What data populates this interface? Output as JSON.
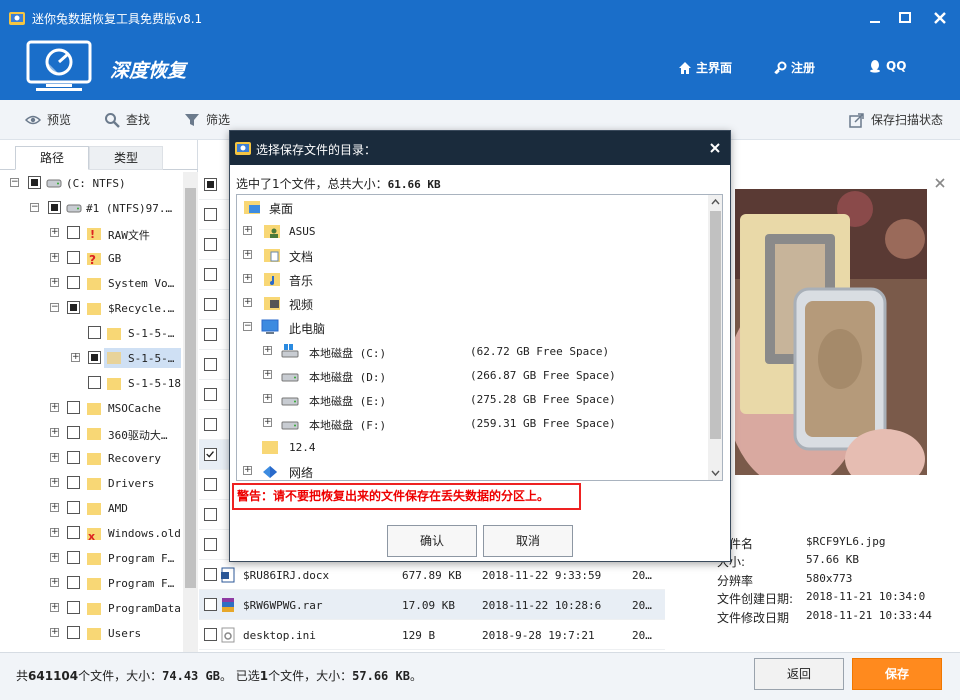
{
  "window": {
    "title": "迷你兔数据恢复工具免费版v8.1"
  },
  "header": {
    "brand": "深度恢复",
    "nav": [
      {
        "label": "主界面",
        "icon": "home-icon"
      },
      {
        "label": "注册",
        "icon": "key-icon"
      },
      {
        "label": "QQ",
        "icon": "qq-icon"
      }
    ]
  },
  "toolbar": {
    "preview": "预览",
    "search": "查找",
    "filter": "筛选",
    "save_scan": "保存扫描状态"
  },
  "left": {
    "tabs": [
      "路径",
      "类型"
    ],
    "tree": [
      {
        "label": "(C: NTFS)"
      },
      {
        "label": "#1 (NTFS)97.…"
      },
      {
        "label": "RAW文件"
      },
      {
        "label": "GB"
      },
      {
        "label": "System Vo…"
      },
      {
        "label": "$Recycle.…"
      },
      {
        "label": "S-1-5-…"
      },
      {
        "label": "S-1-5-…"
      },
      {
        "label": "S-1-5-18"
      },
      {
        "label": "MSOCache"
      },
      {
        "label": "360驱动大…"
      },
      {
        "label": "Recovery"
      },
      {
        "label": "Drivers"
      },
      {
        "label": "AMD"
      },
      {
        "label": "Windows.old"
      },
      {
        "label": "Program F…"
      },
      {
        "label": "Program F…"
      },
      {
        "label": "ProgramData"
      },
      {
        "label": "Users"
      }
    ]
  },
  "files": [
    {
      "name": "$RU86IRJ.docx",
      "size": "677.89 KB",
      "date": "2018-11-22 9:33:59",
      "extra": "20…"
    },
    {
      "name": "$RW6WPWG.rar",
      "size": "17.09 KB",
      "date": "2018-11-22 10:28:6",
      "extra": "20…"
    },
    {
      "name": "desktop.ini",
      "size": "129 B",
      "date": "2018-9-28 19:7:21",
      "extra": "20…"
    }
  ],
  "preview": {
    "info": [
      {
        "k": "文件名",
        "v": "$RCF9YL6.jpg"
      },
      {
        "k": "大小:",
        "v": "57.66 KB"
      },
      {
        "k": "分辨率",
        "v": "580x773"
      },
      {
        "k": "文件创建日期:",
        "v": "2018-11-21 10:34:0"
      },
      {
        "k": "文件修改日期",
        "v": "2018-11-21 10:33:44"
      }
    ]
  },
  "status": {
    "text_prefix": "共",
    "file_count": "641104",
    "text_mid1": "个文件，大小：",
    "total_size": "74.43 GB",
    "text_mid2": "。 已选",
    "selected_count": "1",
    "text_mid3": "个文件，大小：",
    "selected_size": "57.66 KB",
    "text_suffix": "。",
    "back": "返回",
    "save": "保存"
  },
  "dialog": {
    "title": "选择保存文件的目录：",
    "summary_prefix": "选中了1个文件，总共大小：",
    "summary_size": "61.66 KB",
    "items": [
      {
        "label": "桌面"
      },
      {
        "label": "ASUS"
      },
      {
        "label": "文档"
      },
      {
        "label": "音乐"
      },
      {
        "label": "视频"
      },
      {
        "label": "此电脑"
      },
      {
        "label": "本地磁盘 (C:)",
        "free": "(62.72 GB Free Space)"
      },
      {
        "label": "本地磁盘 (D:)",
        "free": "(266.87 GB Free Space)"
      },
      {
        "label": "本地磁盘 (E:)",
        "free": "(275.28 GB Free Space)"
      },
      {
        "label": "本地磁盘 (F:)",
        "free": "(259.31 GB Free Space)"
      },
      {
        "label": "12.4"
      },
      {
        "label": "网络"
      }
    ],
    "warning": "警告：请不要把恢复出来的文件保存在丢失数据的分区上。",
    "ok": "确认",
    "cancel": "取消"
  },
  "colors": {
    "accent": "#1a6ec9",
    "dialog_title": "#1a2b3c",
    "save": "#ff8a1e",
    "warning": "#e00000"
  }
}
